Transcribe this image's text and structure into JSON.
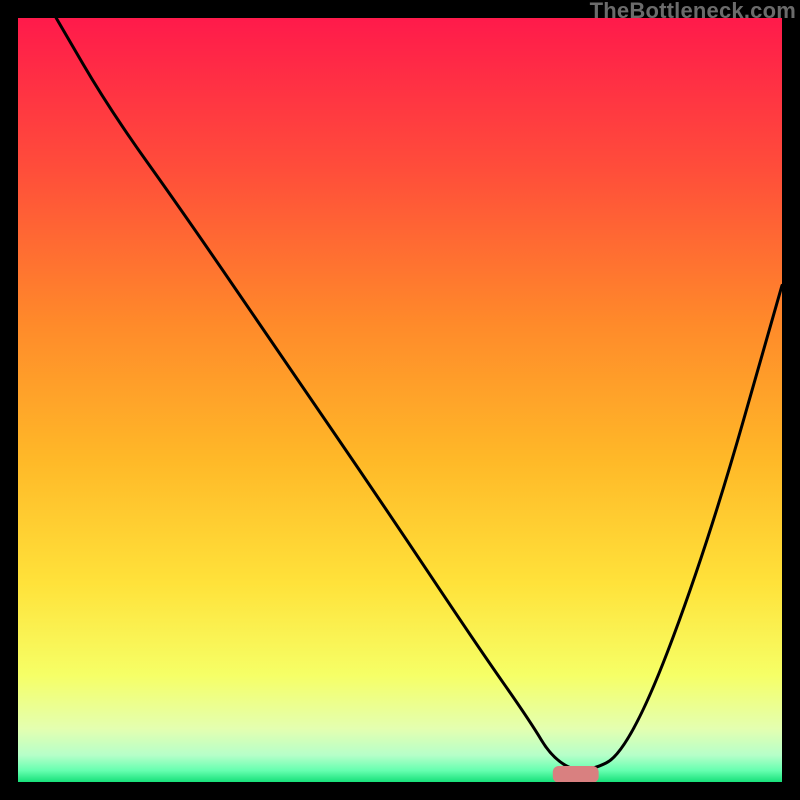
{
  "watermark": "TheBottleneck.com",
  "chart_data": {
    "type": "line",
    "title": "",
    "xlabel": "",
    "ylabel": "",
    "xlim": [
      0,
      100
    ],
    "ylim": [
      0,
      100
    ],
    "grid": false,
    "legend": false,
    "gradient_stops": [
      {
        "offset": 0,
        "color": "#ff1a4b"
      },
      {
        "offset": 0.2,
        "color": "#ff4e3a"
      },
      {
        "offset": 0.4,
        "color": "#ff8a2a"
      },
      {
        "offset": 0.58,
        "color": "#ffb928"
      },
      {
        "offset": 0.74,
        "color": "#ffe23a"
      },
      {
        "offset": 0.86,
        "color": "#f6ff66"
      },
      {
        "offset": 0.93,
        "color": "#e4ffb0"
      },
      {
        "offset": 0.965,
        "color": "#b6ffc9"
      },
      {
        "offset": 0.985,
        "color": "#66ffb0"
      },
      {
        "offset": 1.0,
        "color": "#17e07a"
      }
    ],
    "series": [
      {
        "name": "bottleneck-curve",
        "color": "#000000",
        "x": [
          5,
          12,
          22,
          35,
          48,
          60,
          67,
          70,
          74,
          80,
          90,
          100
        ],
        "values": [
          100,
          88,
          74,
          55,
          36,
          18,
          8,
          3,
          1,
          4,
          30,
          65
        ]
      }
    ],
    "marker": {
      "x": 73,
      "y": 1,
      "width": 6,
      "height": 2.2,
      "color": "#d98080"
    }
  }
}
